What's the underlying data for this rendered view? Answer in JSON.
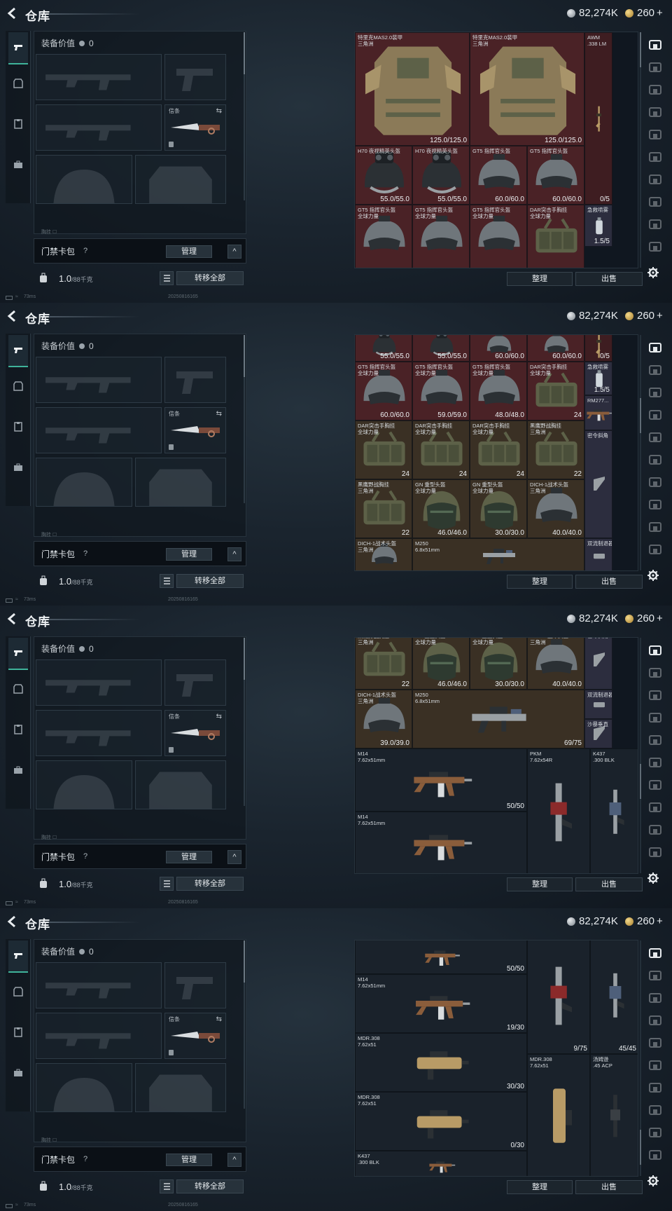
{
  "header": {
    "title": "仓库",
    "silver": "82,274K",
    "gold": "260",
    "gold_plus": "+"
  },
  "loadout": {
    "value_label": "装备价值",
    "value": "0",
    "knife_label": "信条",
    "swap": "⇆",
    "faded_label": "胸挂 ☐",
    "card_pack_label": "门禁卡包",
    "help": "?",
    "manage": "管理",
    "expand": "^",
    "weight": "1.0",
    "weight_cap": "/88千克",
    "transfer_all": "转移全部"
  },
  "status": {
    "ping": "73ms",
    "build": "20250816165"
  },
  "inventory": {
    "sort_label": "整理",
    "sell_label": "出售"
  },
  "panels": [
    {
      "cells": [
        {
          "name": "特里克MAS2.0装甲\n三角洲",
          "count": "125.0/125.0",
          "icon": "armor-vest-icon",
          "bg": "red"
        },
        {
          "name": "特里克MAS2.0装甲\n三角洲",
          "count": "125.0/125.0",
          "icon": "armor-vest-icon",
          "bg": "red"
        },
        {
          "name": "AWM\n.338 LM",
          "count": "0/5",
          "icon": "sniper-rifle-icon",
          "bg": "redd"
        },
        {
          "name": "H70 夜视精英头盔",
          "count": "55.0/55.0",
          "icon": "nvg-helmet-icon",
          "bg": "red"
        },
        {
          "name": "H70 夜视精英头盔",
          "count": "55.0/55.0",
          "icon": "nvg-helmet-icon",
          "bg": "red"
        },
        {
          "name": "GT5 指挥官头盔",
          "count": "60.0/60.0",
          "icon": "helmet-icon",
          "bg": "red"
        },
        {
          "name": "GT5 指挥官头盔",
          "count": "60.0/60.0",
          "icon": "helmet-icon",
          "bg": "red"
        },
        {
          "name": "急救喷雾",
          "count": "1.5/5",
          "icon": "spray-icon",
          "bg": "purple"
        },
        {
          "name": "GT5 指挥官头盔\n全球力量",
          "count": "",
          "icon": "helmet-icon",
          "bg": "red"
        },
        {
          "name": "GT5 指挥官头盔\n全球力量",
          "count": "",
          "icon": "helmet-icon",
          "bg": "red"
        },
        {
          "name": "GT5 指挥官头盔\n全球力量",
          "count": "",
          "icon": "helmet-icon",
          "bg": "red"
        },
        {
          "name": "DAR突击手胸挂\n全球力量",
          "count": "",
          "icon": "chest-rig-icon",
          "bg": "red"
        }
      ]
    },
    {
      "cells": [
        {
          "name": "",
          "count": "55.0/55.0",
          "icon": "nvg-helmet-icon",
          "bg": "red"
        },
        {
          "name": "",
          "count": "55.0/55.0",
          "icon": "nvg-helmet-icon",
          "bg": "red"
        },
        {
          "name": "",
          "count": "60.0/60.0",
          "icon": "helmet-icon",
          "bg": "red"
        },
        {
          "name": "",
          "count": "60.0/60.0",
          "icon": "helmet-icon",
          "bg": "red"
        },
        {
          "name": "",
          "count": "0/5",
          "icon": "sniper-rifle-icon",
          "bg": "redd"
        },
        {
          "name": "GT5 指挥官头盔\n全球力量",
          "count": "60.0/60.0",
          "icon": "helmet-icon",
          "bg": "red"
        },
        {
          "name": "GT5 指挥官头盔\n全球力量",
          "count": "59.0/59.0",
          "icon": "helmet-icon",
          "bg": "red"
        },
        {
          "name": "GT5 指挥官头盔\n全球力量",
          "count": "48.0/48.0",
          "icon": "helmet-icon",
          "bg": "red"
        },
        {
          "name": "DAR突击手胸挂\n全球力量",
          "count": "24",
          "icon": "chest-rig-icon",
          "bg": "red"
        },
        {
          "name": "急救喷雾",
          "count": "1.5/5",
          "icon": "spray-icon",
          "bg": "purple"
        },
        {
          "name": "DAR突击手胸挂\n全球力量",
          "count": "24",
          "icon": "chest-rig-icon",
          "bg": "brown"
        },
        {
          "name": "DAR突击手胸挂\n全球力量",
          "count": "24",
          "icon": "chest-rig-icon",
          "bg": "brown"
        },
        {
          "name": "DAR突击手胸挂\n全球力量",
          "count": "24",
          "icon": "chest-rig-icon",
          "bg": "brown"
        },
        {
          "name": "黑鹰野战胸挂\n三角洲",
          "count": "22",
          "icon": "chest-rig-icon",
          "bg": "brown"
        },
        {
          "name": "RM277...",
          "count": "",
          "icon": "rifle-icon",
          "bg": "purple"
        },
        {
          "name": "黑鹰野战胸挂\n三角洲",
          "count": "22",
          "icon": "chest-rig-icon",
          "bg": "brown"
        },
        {
          "name": "GN 重型头盔\n全球力量",
          "count": "46.0/46.0",
          "icon": "heavy-helmet-icon",
          "bg": "brown"
        },
        {
          "name": "GN 重型头盔\n全球力量",
          "count": "30.0/30.0",
          "icon": "heavy-helmet-icon",
          "bg": "brown"
        },
        {
          "name": "DICH-1战术头盔\n三角洲",
          "count": "40.0/40.0",
          "icon": "helmet-icon",
          "bg": "brown"
        },
        {
          "name": "密令斜角",
          "count": "",
          "icon": "grip-icon",
          "bg": "purple"
        },
        {
          "name": "DICH-1战术头盔\n三角洲",
          "count": "",
          "icon": "helmet-icon",
          "bg": "brown"
        },
        {
          "name": "M250\n6.8x51mm",
          "count": "",
          "icon": "mg-icon",
          "bg": "brown"
        },
        {
          "name": "双流制退器",
          "count": "",
          "icon": "muzzle-icon",
          "bg": "purple"
        }
      ]
    },
    {
      "cells": [
        {
          "name": "黑鹰野战胸挂\n三角洲",
          "count": "22",
          "icon": "chest-rig-icon",
          "bg": "brown"
        },
        {
          "name": "GN 重型头盔\n全球力量",
          "count": "46.0/46.0",
          "icon": "heavy-helmet-icon",
          "bg": "brown"
        },
        {
          "name": "GN 重型头盔\n全球力量",
          "count": "30.0/30.0",
          "icon": "heavy-helmet-icon",
          "bg": "brown"
        },
        {
          "name": "DICH-1战术头盔\n三角洲",
          "count": "40.0/40.0",
          "icon": "helmet-icon",
          "bg": "brown"
        },
        {
          "name": "密令斜角",
          "count": "",
          "icon": "grip-icon",
          "bg": "purple"
        },
        {
          "name": "DICH-1战术头盔\n三角洲",
          "count": "39.0/39.0",
          "icon": "helmet-icon",
          "bg": "brown"
        },
        {
          "name": "M250\n6.8x51mm",
          "count": "69/75",
          "icon": "mg-icon",
          "bg": "brown"
        },
        {
          "name": "双流制退器",
          "count": "",
          "icon": "muzzle-icon",
          "bg": "purple"
        },
        {
          "name": "沙暴垂直",
          "count": "",
          "icon": "grip-icon",
          "bg": "purple"
        },
        {
          "name": "M14\n7.62x51mm",
          "count": "50/50",
          "icon": "rifle-icon",
          "bg": "dark"
        },
        {
          "name": "PKM\n7.62x54R",
          "count": "",
          "icon": "mg-vertical-icon",
          "bg": "dark"
        },
        {
          "name": "K437\n.300 BLK",
          "count": "",
          "icon": "rifle-vertical-icon",
          "bg": "dark"
        },
        {
          "name": "M14\n7.62x51mm",
          "count": "",
          "icon": "rifle-icon",
          "bg": "dark"
        }
      ]
    },
    {
      "cells": [
        {
          "name": "",
          "count": "50/50",
          "icon": "rifle-icon",
          "bg": "dark"
        },
        {
          "name": "",
          "count": "9/75",
          "icon": "mg-vertical-icon",
          "bg": "dark"
        },
        {
          "name": "",
          "count": "45/45",
          "icon": "rifle-vertical-icon",
          "bg": "dark"
        },
        {
          "name": "M14\n7.62x51mm",
          "count": "19/30",
          "icon": "rifle-icon",
          "bg": "dark"
        },
        {
          "name": "MDR.308\n7.62x51",
          "count": "30/30",
          "icon": "bullpup-icon",
          "bg": "dark"
        },
        {
          "name": "MDR.308\n7.62x51",
          "count": "",
          "icon": "bullpup-vertical-icon",
          "bg": "dark"
        },
        {
          "name": "汤姆逊\n.45 ACP",
          "count": "",
          "icon": "smg-vertical-icon",
          "bg": "dark"
        },
        {
          "name": "MDR.308\n7.62x51",
          "count": "0/30",
          "icon": "bullpup-icon",
          "bg": "dark"
        },
        {
          "name": "K437\n.300 BLK",
          "count": "",
          "icon": "rifle-icon",
          "bg": "dark"
        }
      ]
    }
  ]
}
